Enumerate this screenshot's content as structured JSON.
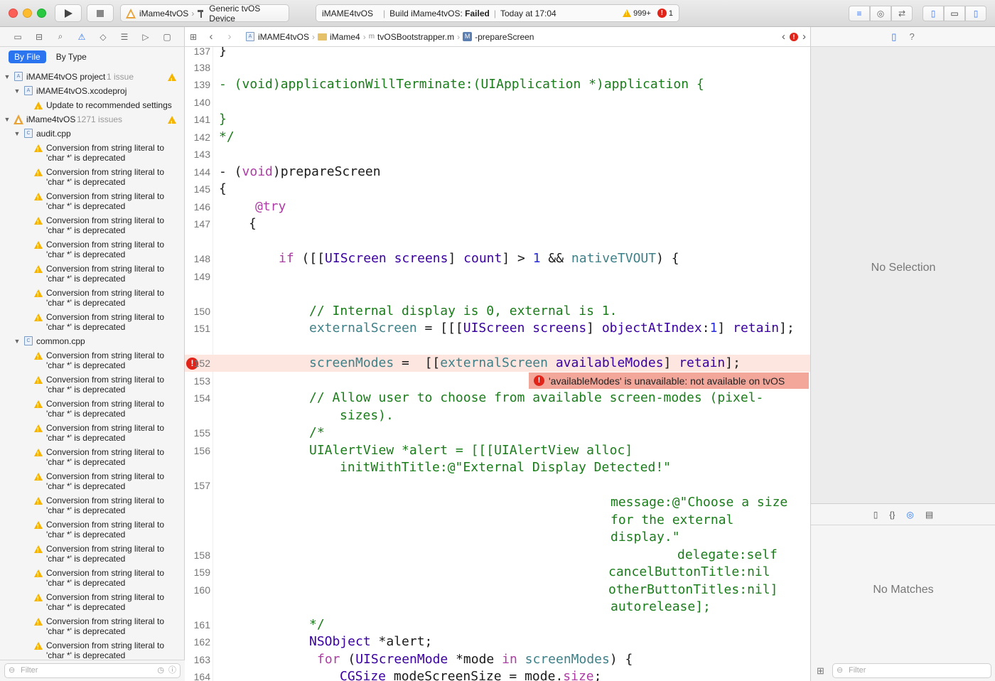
{
  "toolbar": {
    "scheme_project": "iMame4tvOS",
    "scheme_device": "Generic tvOS Device",
    "activity_project": "iMAME4tvOS",
    "activity_build_prefix": "Build iMame4tvOS: ",
    "activity_build_status": "Failed",
    "activity_time": "Today at 17:04",
    "warning_count": "999+",
    "error_count": "1"
  },
  "navigator": {
    "tab_by_file": "By File",
    "tab_by_type": "By Type",
    "project_name": "iMAME4tvOS project",
    "project_issues": "1 issue",
    "xcodeproj": "iMAME4tvOS.xcodeproj",
    "update_warning": "Update to recommended settings",
    "target_name": "iMame4tvOS",
    "target_issues": "1271 issues",
    "file1": "audit.cpp",
    "file2": "common.cpp",
    "warning_line1": "Conversion from string literal to",
    "warning_line2": "'char *' is deprecated",
    "filter_placeholder": "Filter"
  },
  "jumpbar": {
    "crumb1": "iMAME4tvOS",
    "crumb2": "iMame4",
    "crumb3": "tvOSBootstrapper.m",
    "crumb4": "-prepareScreen"
  },
  "editor": {
    "error_message": "'availableModes' is unavailable: not available on tvOS"
  },
  "inspector": {
    "no_selection": "No Selection",
    "no_matches": "No Matches",
    "filter_placeholder": "Filter"
  },
  "colors": {
    "accent": "#2a74f0",
    "error": "#e0241a",
    "warning": "#f5b400",
    "error_line_bg": "#fde5e0",
    "error_banner_bg": "#f3a79b"
  }
}
